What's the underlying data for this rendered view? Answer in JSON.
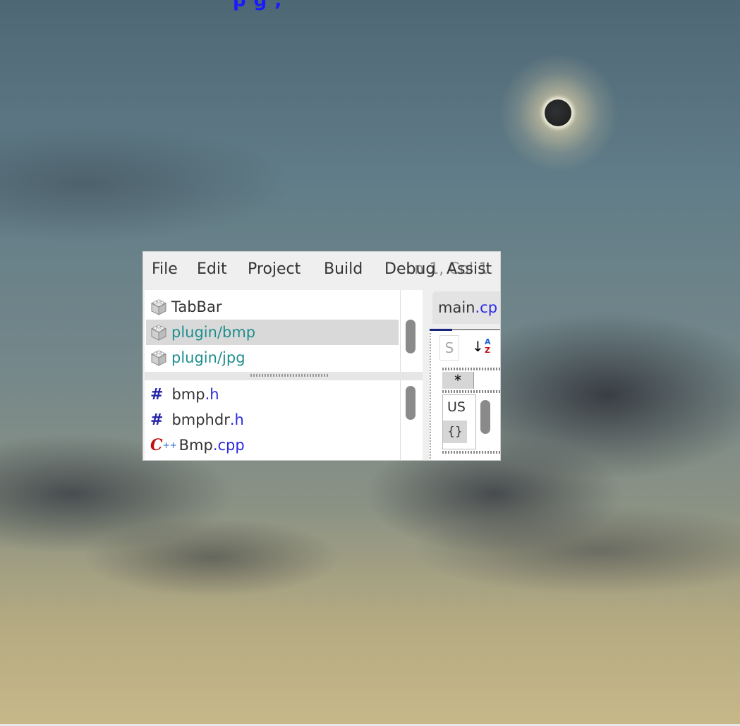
{
  "header_clip_text": "p g ,",
  "menu": {
    "file": "File",
    "edit": "Edit",
    "project": "Project",
    "build": "Build",
    "debug": "Debug",
    "assist": "Assist"
  },
  "status_overlay": "Ln 1, Col 1",
  "packages": [
    {
      "label": "TabBar",
      "selected": false
    },
    {
      "label": "plugin/bmp",
      "selected": true
    },
    {
      "label": "plugin/jpg",
      "selected": false
    }
  ],
  "files": [
    {
      "name": "bmp",
      "ext": ".h",
      "type": "header"
    },
    {
      "name": "bmphdr",
      "ext": ".h",
      "type": "header"
    },
    {
      "name": "Bmp",
      "ext": ".cpp",
      "type": "cpp"
    }
  ],
  "editor": {
    "tab_name": "main",
    "tab_ext": ".cp",
    "search_placeholder": "S",
    "sort_glyph": "↓",
    "sort_az": "AZ",
    "star_label": "*",
    "mini_label": "US",
    "brace_label": "{}"
  },
  "colors": {
    "teal_label": "#1f8e8e",
    "ext_blue": "#2a2ae0",
    "hash_blue": "#2424a8",
    "cpp_red": "#c01010",
    "selected_row": "#d9d9d9"
  }
}
